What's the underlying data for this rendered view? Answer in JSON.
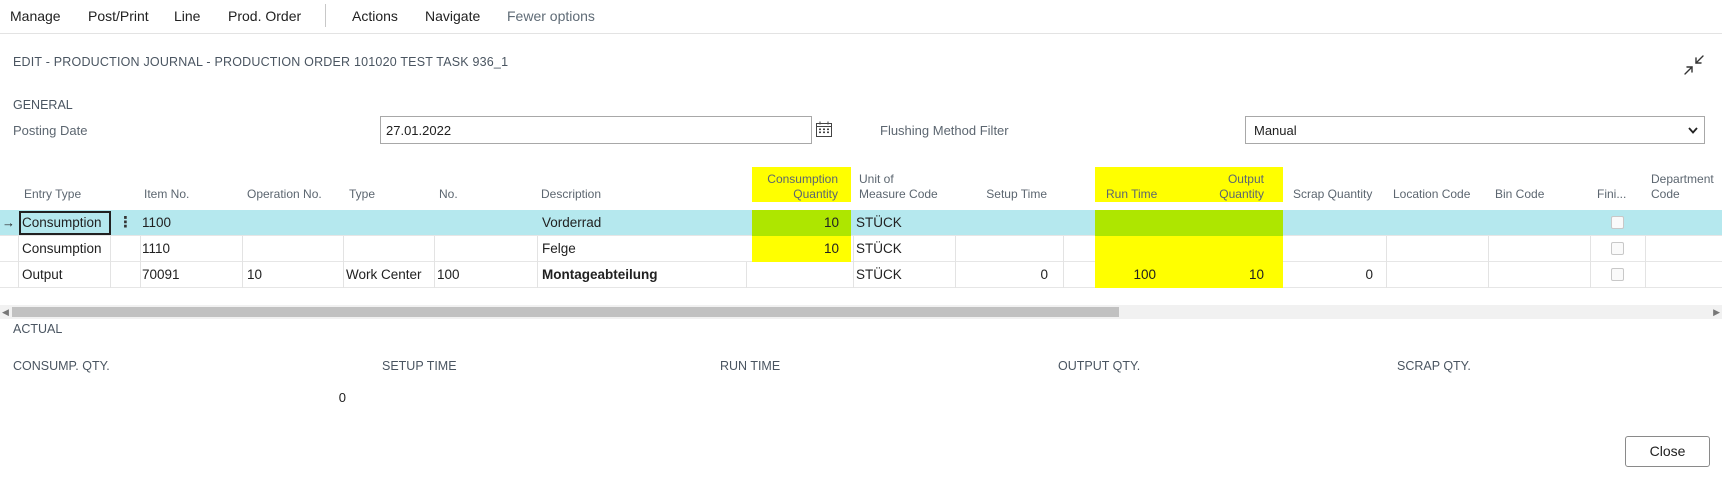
{
  "menu": {
    "items": [
      "Manage",
      "Post/Print",
      "Line",
      "Prod. Order"
    ],
    "actions": "Actions",
    "navigate": "Navigate",
    "fewer_options": "Fewer options"
  },
  "page": {
    "title": "EDIT - PRODUCTION JOURNAL - PRODUCTION ORDER 101020 TEST TASK 936_1"
  },
  "general": {
    "section_title": "GENERAL",
    "posting_date_label": "Posting Date",
    "posting_date_value": "27.01.2022",
    "flushing_label": "Flushing Method Filter",
    "flushing_value": "Manual"
  },
  "grid": {
    "headers": {
      "entry_type": "Entry Type",
      "item_no": "Item No.",
      "operation_no": "Operation No.",
      "type": "Type",
      "no": "No.",
      "description": "Description",
      "consumption_qty_1": "Consumption",
      "consumption_qty_2": "Quantity",
      "uom_1": "Unit of",
      "uom_2": "Measure Code",
      "setup_time": "Setup Time",
      "run_time": "Run Time",
      "output_qty_1": "Output",
      "output_qty_2": "Quantity",
      "scrap_qty": "Scrap Quantity",
      "location_code": "Location Code",
      "bin_code": "Bin Code",
      "finished": "Fini...",
      "department_1": "Department",
      "department_2": "Code"
    },
    "rows": [
      {
        "entry_type": "Consumption",
        "item_no": "1100",
        "operation_no": "",
        "type": "",
        "no": "",
        "description": "Vorderrad",
        "consumption_qty": "10",
        "uom": "STÜCK",
        "setup_time": "",
        "run_time": "",
        "output_qty": "",
        "scrap_qty": ""
      },
      {
        "entry_type": "Consumption",
        "item_no": "1110",
        "operation_no": "",
        "type": "",
        "no": "",
        "description": "Felge",
        "consumption_qty": "10",
        "uom": "STÜCK",
        "setup_time": "",
        "run_time": "",
        "output_qty": "",
        "scrap_qty": ""
      },
      {
        "entry_type": "Output",
        "item_no": "70091",
        "operation_no": "10",
        "type": "Work Center",
        "no": "100",
        "description": "Montageabteilung",
        "consumption_qty": "",
        "uom": "STÜCK",
        "setup_time": "0",
        "run_time": "100",
        "output_qty": "10",
        "scrap_qty": "0"
      }
    ],
    "selected_row_arrow": "→",
    "row_menu_glyph": "⋮"
  },
  "actual": {
    "section_title": "ACTUAL",
    "consump_qty_label": "CONSUMP. QTY.",
    "setup_time_label": "SETUP TIME",
    "run_time_label": "RUN TIME",
    "output_qty_label": "OUTPUT QTY.",
    "scrap_qty_label": "SCRAP QTY.",
    "consump_qty_value": "0"
  },
  "footer": {
    "close_label": "Close"
  },
  "colors": {
    "highlight": "#ffff00",
    "highlight_selected": "#aee600",
    "selected_row": "#b5e8ee"
  },
  "icons": {
    "collapse": "collapse-arrows-icon",
    "calendar": "calendar-icon",
    "chevron": "chevron-down-icon"
  }
}
